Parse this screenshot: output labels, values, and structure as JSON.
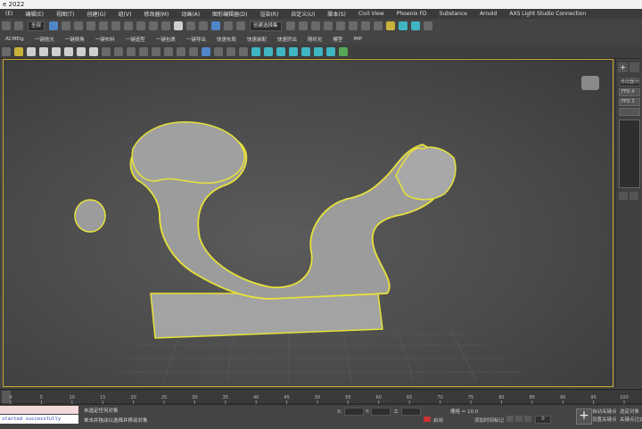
{
  "window": {
    "title": "e 2022"
  },
  "menu": [
    "(E)",
    "编辑(E)",
    "视图(T)",
    "创建(G)",
    "组(V)",
    "修改器(M)",
    "动画(A)",
    "图形编辑器(D)",
    "渲染(R)",
    "自定义(U)",
    "脚本(S)",
    "Civil View",
    "Phoenix FD",
    "Substance",
    "Arnold",
    "AXS Light Studio Connection"
  ],
  "toolbar": {
    "undo_scope": "全部",
    "selection_set": "创建选择集",
    "labels2": [
      "ACMElg",
      "一键抛光",
      "一键倒角",
      "一键布料",
      "一键造型",
      "一键包裹",
      "一键导出",
      "快速布局",
      "快速装配",
      "快速挤出",
      "随机化",
      "模型",
      "IMP"
    ]
  },
  "right_panel": {
    "tab_plus": "+",
    "dropdown": "修改器列表",
    "btn1": "FFD 4",
    "btn2": "FFD 3"
  },
  "timeline": {
    "ticks": [
      "0",
      "5",
      "10",
      "15",
      "20",
      "25",
      "30",
      "35",
      "40",
      "45",
      "50",
      "55",
      "60",
      "65",
      "70",
      "75",
      "80",
      "85",
      "90",
      "95",
      "100"
    ]
  },
  "status": {
    "script_output": "started successfully",
    "prompt_line1": "未选定任何对象",
    "prompt_line2": "单击并拖动以选择并移动对象",
    "x_label": "X:",
    "y_label": "Y:",
    "z_label": "Z:",
    "grid": "栅格 = 10.0",
    "add_time_tag": "添加时间标记",
    "auto_key": "自动关键点",
    "set_key": "设置关键点",
    "selected_object": "选定对象",
    "key_filters": "关键点过滤器",
    "enabled": "启用",
    "frame": "0",
    "plus": "+"
  },
  "colors": {
    "viewport_border": "#c9a92f",
    "selection_outline": "#e7e23a",
    "model_fill": "#9c9c9c"
  }
}
